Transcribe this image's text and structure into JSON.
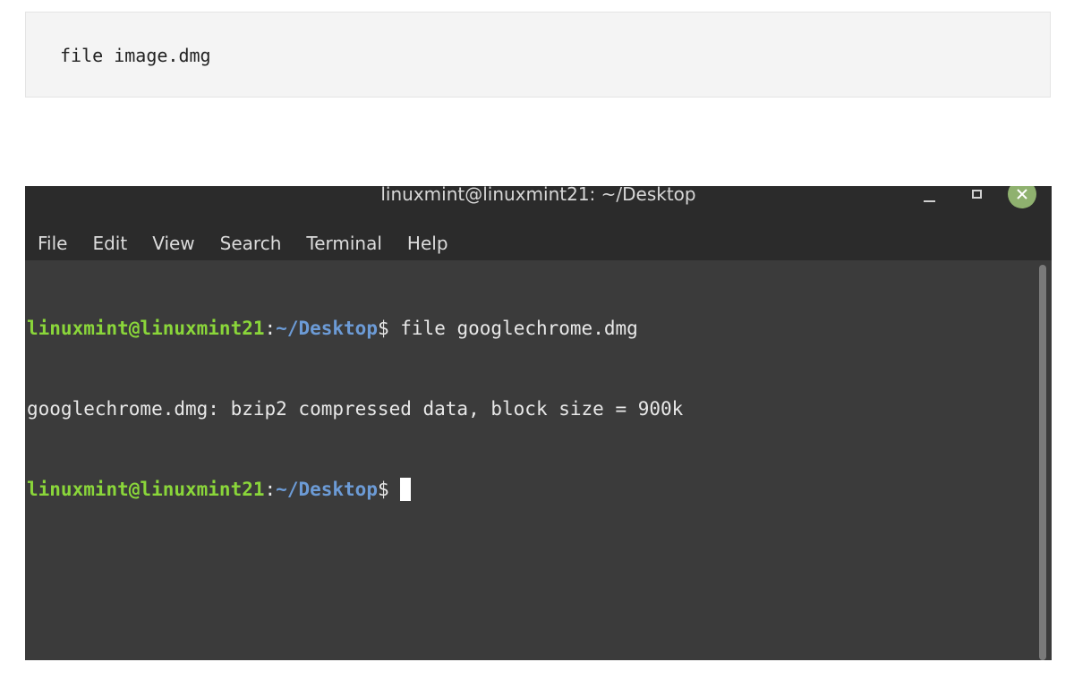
{
  "code_block": {
    "command": "file image.dmg"
  },
  "terminal": {
    "title": "linuxmint@linuxmint21: ~/Desktop",
    "menu": [
      "File",
      "Edit",
      "View",
      "Search",
      "Terminal",
      "Help"
    ],
    "lines": [
      {
        "user": "linuxmint@linuxmint21",
        "sep": ":",
        "path": "~/Desktop",
        "dollar": "$",
        "command": " file googlechrome.dmg"
      },
      {
        "output": "googlechrome.dmg: bzip2 compressed data, block size = 900k"
      },
      {
        "user": "linuxmint@linuxmint21",
        "sep": ":",
        "path": "~/Desktop",
        "dollar": "$",
        "command": " "
      }
    ],
    "colors": {
      "user": "#8ad63a",
      "path": "#6c9bd6",
      "background": "#3b3b3b",
      "close_button": "#8fb16f"
    }
  }
}
